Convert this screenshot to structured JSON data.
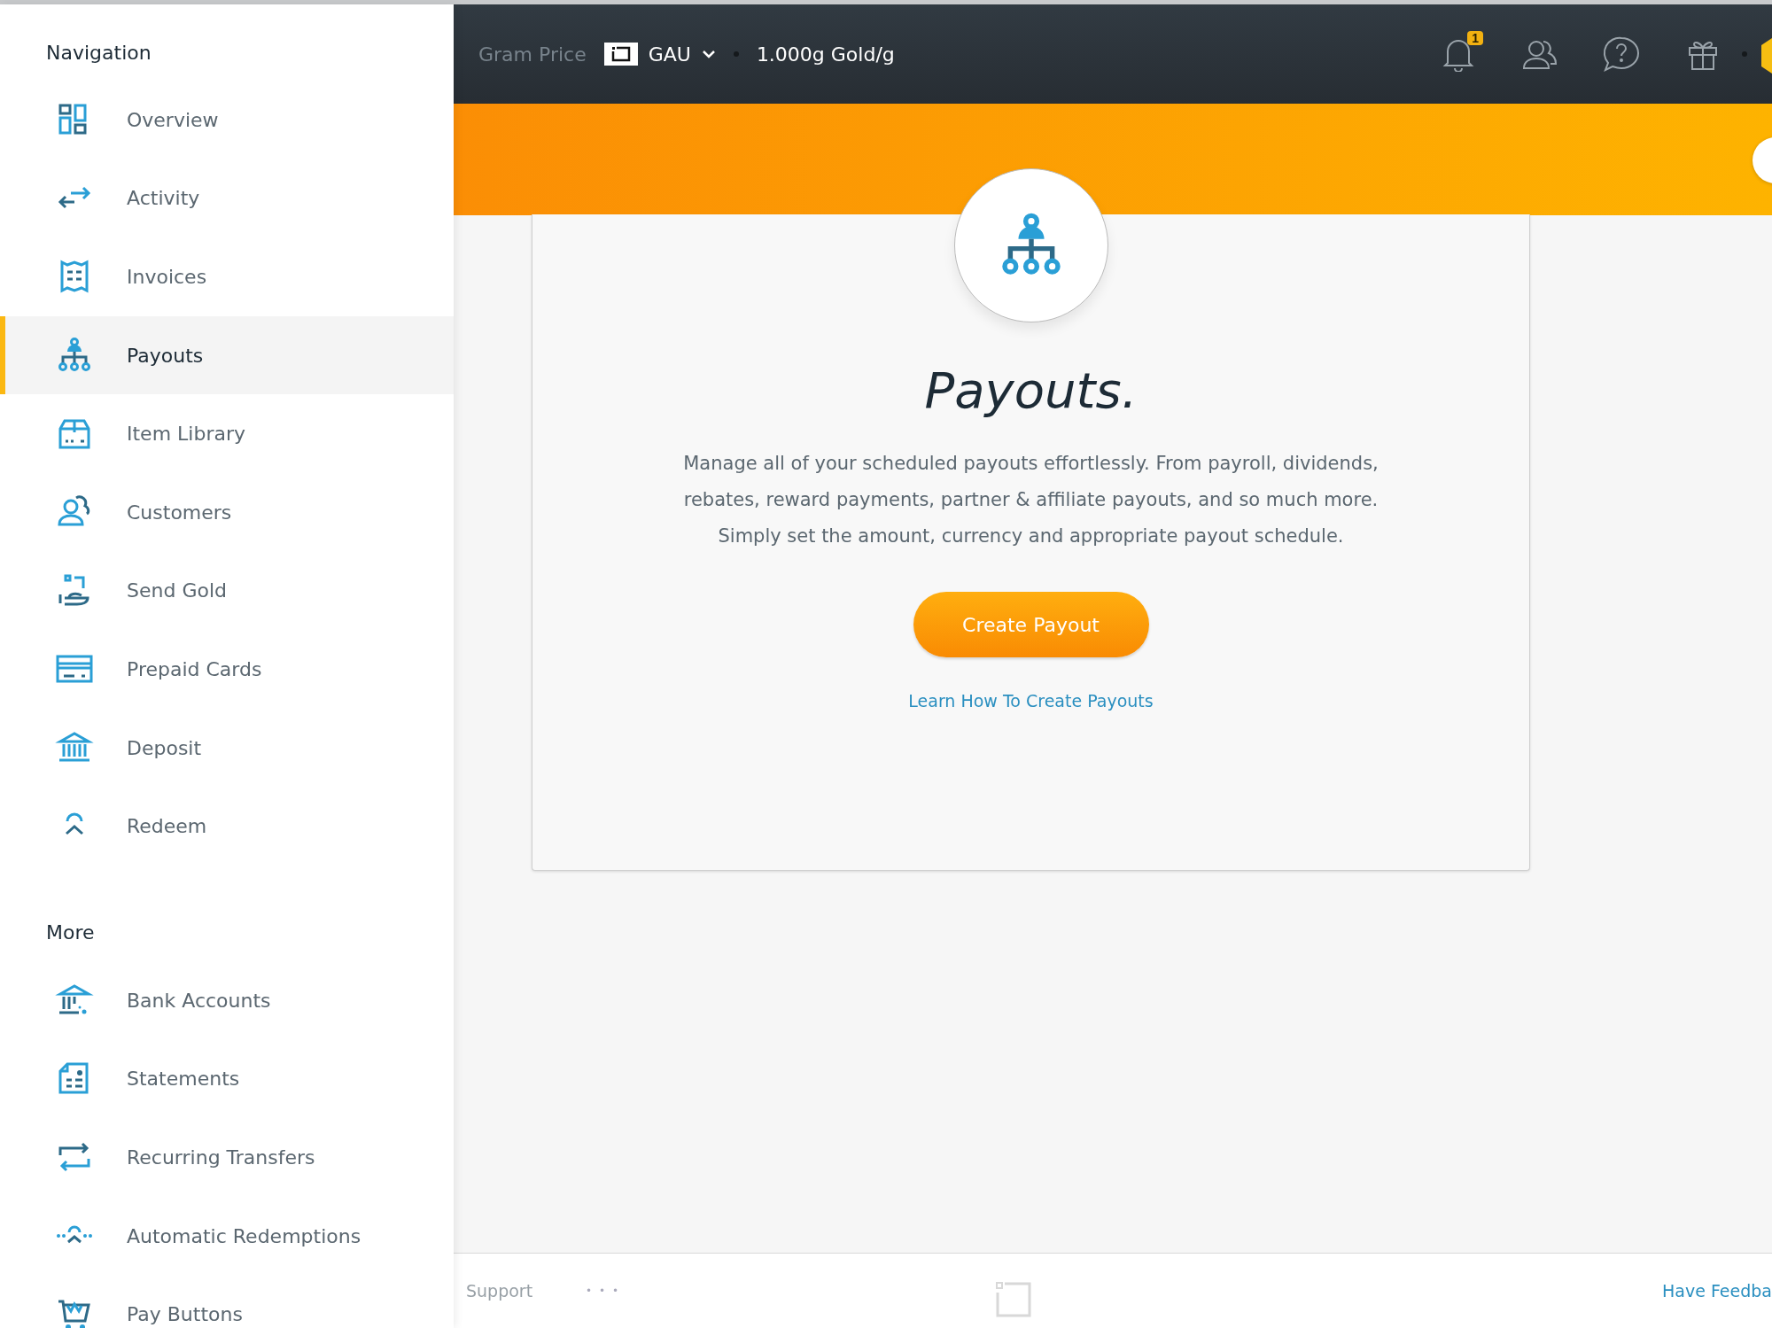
{
  "sidebar": {
    "sections": [
      {
        "heading": "Navigation",
        "items": [
          {
            "label": "Overview",
            "selected": false
          },
          {
            "label": "Activity",
            "selected": false
          },
          {
            "label": "Invoices",
            "selected": false
          },
          {
            "label": "Payouts",
            "selected": true
          },
          {
            "label": "Item Library",
            "selected": false
          },
          {
            "label": "Customers",
            "selected": false
          },
          {
            "label": "Send Gold",
            "selected": false
          },
          {
            "label": "Prepaid Cards",
            "selected": false
          },
          {
            "label": "Deposit",
            "selected": false
          },
          {
            "label": "Redeem",
            "selected": false
          }
        ]
      },
      {
        "heading": "More",
        "items": [
          {
            "label": "Bank Accounts",
            "selected": false
          },
          {
            "label": "Statements",
            "selected": false
          },
          {
            "label": "Recurring Transfers",
            "selected": false
          },
          {
            "label": "Automatic Redemptions",
            "selected": false
          },
          {
            "label": "Pay Buttons",
            "selected": false
          }
        ]
      }
    ]
  },
  "topbar": {
    "price_label": "Gram Price",
    "currency": "GAU",
    "price": "1.000g Gold/g",
    "notification_count": "1"
  },
  "card": {
    "title": "Payouts.",
    "description": "Manage all of your scheduled payouts effortlessly. From payroll, dividends, rebates, reward payments, partner & affiliate payouts, and so much more. Simply set the amount, currency and appropriate payout schedule.",
    "button": "Create Payout",
    "link": "Learn How To Create Payouts"
  },
  "footer": {
    "support": "Support",
    "more": "• • •",
    "feedback": "Have Feedba"
  }
}
